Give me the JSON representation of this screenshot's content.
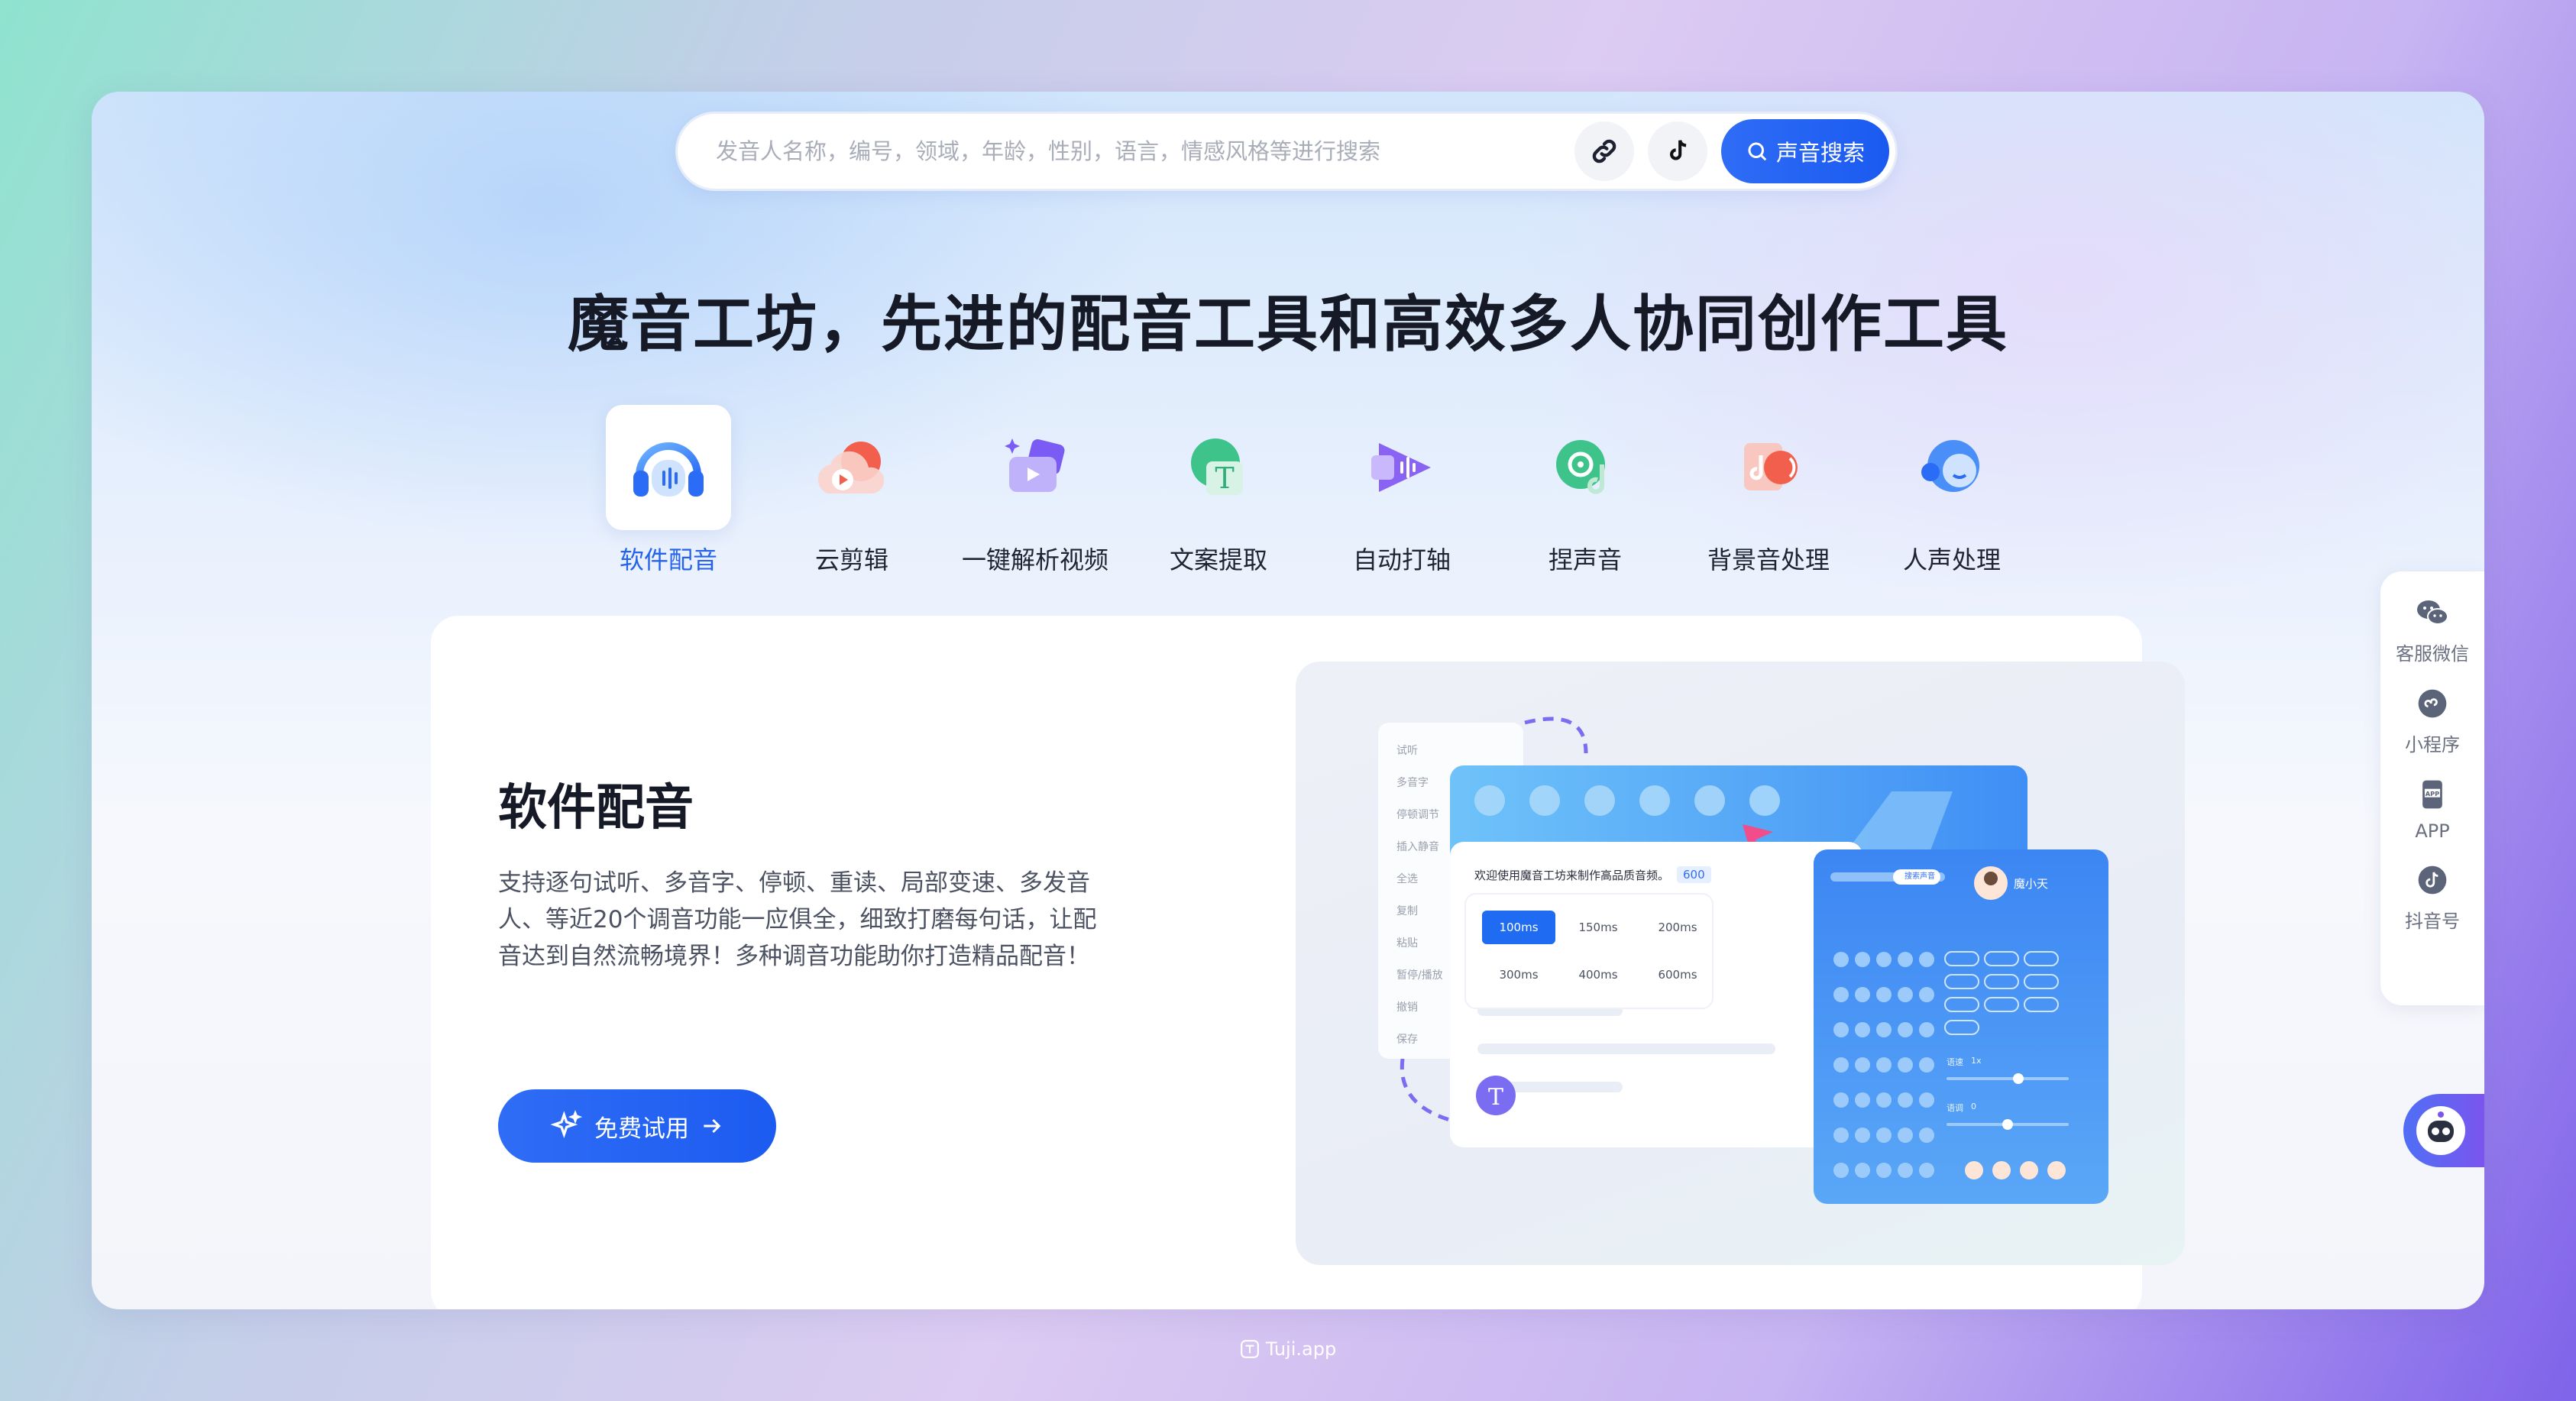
{
  "search": {
    "placeholder": "发音人名称，编号，领域，年龄，性别，语言，情感风格等进行搜索",
    "button_label": "声音搜索"
  },
  "headline": "魔音工坊，先进的配音工具和高效多人协同创作工具",
  "tools": [
    {
      "label": "软件配音",
      "icon": "headphones-icon",
      "active": true
    },
    {
      "label": "云剪辑",
      "icon": "cloud-video-icon"
    },
    {
      "label": "一键解析视频",
      "icon": "video-parse-icon"
    },
    {
      "label": "文案提取",
      "icon": "text-extract-icon"
    },
    {
      "label": "自动打轴",
      "icon": "auto-timeline-icon"
    },
    {
      "label": "捏声音",
      "icon": "voice-shape-icon"
    },
    {
      "label": "背景音处理",
      "icon": "background-sound-icon"
    },
    {
      "label": "人声处理",
      "icon": "vocal-process-icon"
    }
  ],
  "feature": {
    "title": "软件配音",
    "description": "支持逐句试听、多音字、停顿、重读、局部变速、多发音人、等近20个调音功能一应俱全，细致打磨每句话，让配音达到自然流畅境界！多种调音功能助你打造精品配音！",
    "cta_label": "免费试用"
  },
  "preview": {
    "menu": [
      "试听",
      "多音字",
      "停顿调节",
      "插入静音",
      "全选",
      "复制",
      "粘贴",
      "暂停/播放",
      "撤销",
      "保存"
    ],
    "welcome": "欢迎使用魔音工坊来制作高品质音频。",
    "count": "600",
    "pauses": [
      "100ms",
      "150ms",
      "200ms",
      "300ms",
      "400ms",
      "600ms"
    ],
    "speaker_name": "魔小天",
    "speaker_tag": "搜索声音",
    "speed_label": "语速",
    "speed_value": "1x",
    "pitch_label": "语调",
    "pitch_value": "0"
  },
  "dock": [
    {
      "label": "客服微信",
      "icon": "wechat-icon"
    },
    {
      "label": "小程序",
      "icon": "mini-program-icon"
    },
    {
      "label": "APP",
      "icon": "app-icon"
    },
    {
      "label": "抖音号",
      "icon": "tiktok-icon"
    }
  ],
  "footer": "Tuji.app",
  "colors": {
    "accent": "#2563eb",
    "title": "#161a27"
  }
}
